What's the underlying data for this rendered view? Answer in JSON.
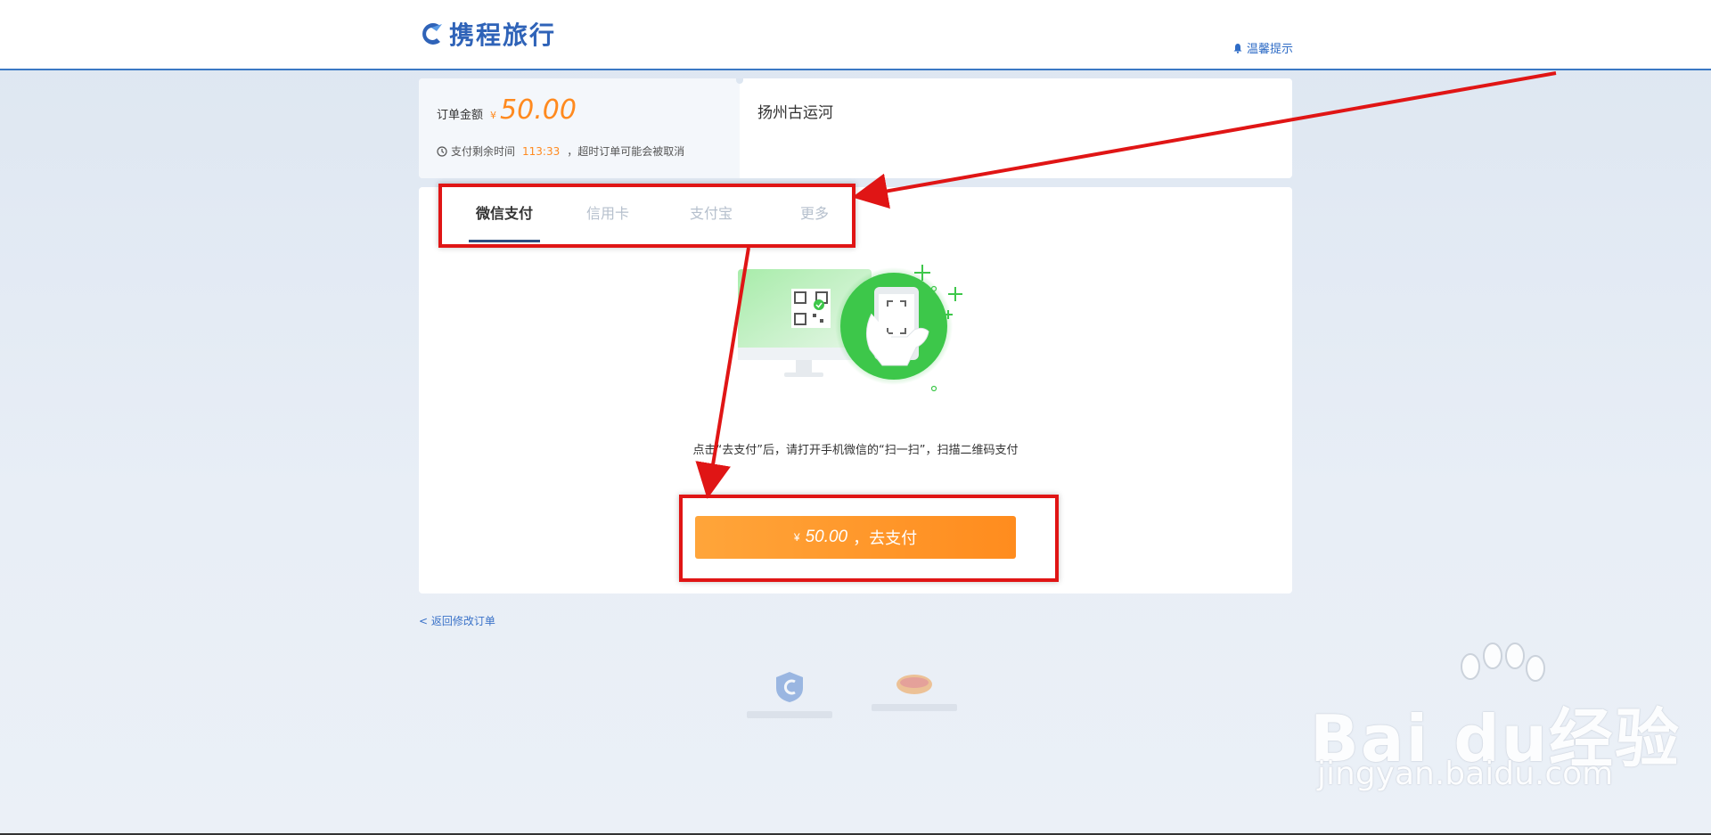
{
  "header": {
    "logo_text": "携程旅行",
    "notice_label": "温馨提示"
  },
  "order": {
    "amount_label": "订单金额",
    "currency": "¥",
    "amount": "50.00",
    "timer_prefix": "支付剩余时间",
    "timer_value": "113:33",
    "timer_suffix": "，超时订单可能会被取消",
    "product_name": "扬州古运河"
  },
  "payment": {
    "tabs": [
      {
        "label": "微信支付",
        "active": true
      },
      {
        "label": "信用卡",
        "active": false
      },
      {
        "label": "支付宝",
        "active": false
      },
      {
        "label": "更多",
        "active": false
      }
    ],
    "hint": "点击“去支付”后，请打开手机微信的“扫一扫”，扫描二维码支付",
    "button_currency": "¥",
    "button_amount": "50.00",
    "button_suffix": "，去支付"
  },
  "back_link": "< 返回修改订单",
  "colors": {
    "accent_orange": "#ff8a1f",
    "brand_blue": "#2f63b8",
    "wechat_green": "#3dc74a",
    "annotation_red": "#e01515"
  },
  "watermark": {
    "main": "Bai du经验",
    "sub": "jingyan.baidu.com"
  }
}
